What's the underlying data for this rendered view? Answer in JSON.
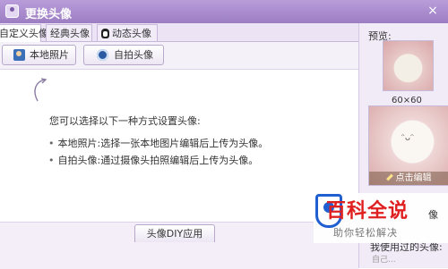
{
  "window": {
    "title": "更换头像",
    "close_glyph": "×"
  },
  "tabs": [
    {
      "label": "自定义头像",
      "active": true
    },
    {
      "label": "经典头像",
      "active": false
    },
    {
      "label": "动态头像",
      "active": false
    }
  ],
  "toolbar": {
    "local_photo_label": "本地照片",
    "selfie_label": "自拍头像"
  },
  "main": {
    "intro": "您可以选择以下一种方式设置头像:",
    "options": [
      "本地照片:选择一张本地图片编辑后上传为头像。",
      "自拍头像:通过摄像头拍照编辑后上传为头像。"
    ],
    "bullet": "•"
  },
  "bottom": {
    "diy_label": "头像DIY应用"
  },
  "preview": {
    "label": "预览:",
    "small_size": "60×60",
    "edit_label": "点击编辑",
    "used_label": "我使用过的头像:",
    "used_partial": "自己..."
  },
  "watermark": {
    "title": "百科全说",
    "subtitle": "助你轻松解决",
    "fragment": "像"
  },
  "colors": {
    "accent": "#9c7dc3",
    "brand_red": "#e02020",
    "brand_blue": "#1f5fd1"
  },
  "icons": [
    "app-icon",
    "close-icon",
    "penguin-icon",
    "photo-icon",
    "camera-icon",
    "arrow-icon",
    "pencil-icon",
    "logo-icon"
  ]
}
